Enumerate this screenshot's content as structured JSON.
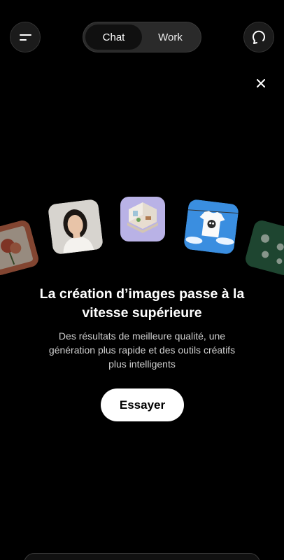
{
  "header": {
    "menu_icon": "menu-icon",
    "modes": [
      {
        "label": "Chat",
        "active": true
      },
      {
        "label": "Work",
        "active": false
      }
    ],
    "new_chat_icon": "chat-refresh-icon"
  },
  "promo": {
    "close_icon": "close-icon",
    "headline": "La création d’images passe à la vitesse supérieure",
    "description": "Des résultats de meilleure qualité, une génération plus rapide et des outils créatifs plus intelligents",
    "button_label": "Essayer",
    "tiles": [
      "flower-painting-image",
      "portrait-photo-image",
      "isometric-room-image",
      "tshirt-clothesline-image",
      "green-pattern-image"
    ]
  },
  "colors": {
    "background": "#000000",
    "button_bg": "#ffffff",
    "muted_text": "#cfcfcf"
  }
}
